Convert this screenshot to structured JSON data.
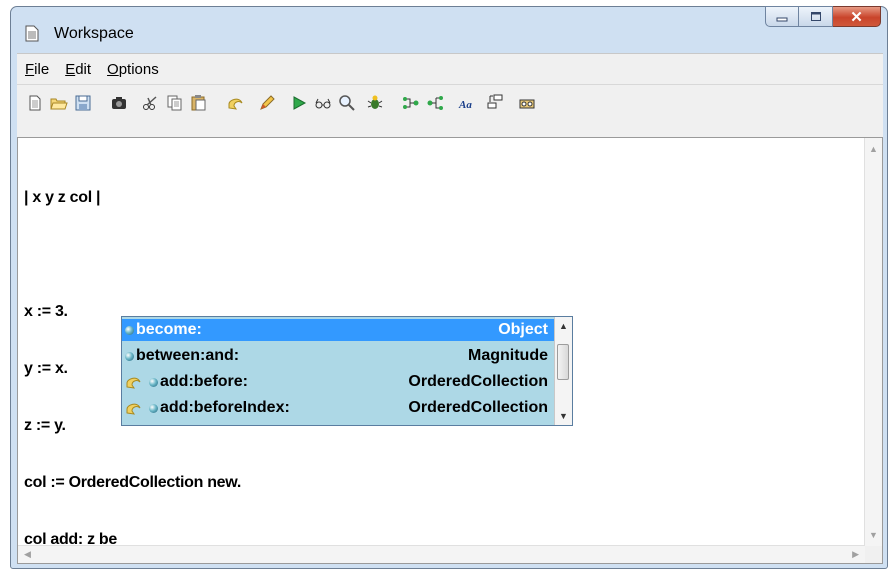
{
  "window": {
    "title": "Workspace"
  },
  "menu": {
    "items": [
      "File",
      "Edit",
      "Options"
    ]
  },
  "toolbar": {
    "icons": [
      "new-document-icon",
      "open-folder-icon",
      "save-icon",
      "camera-icon",
      "cut-icon",
      "copy-icon",
      "paste-icon",
      "undo-icon",
      "highlighter-icon",
      "run-icon",
      "inspect-glasses-icon",
      "magnifier-icon",
      "bug-icon",
      "step-into-icon",
      "step-over-icon",
      "font-icon",
      "structure-icon",
      "tape-icon"
    ]
  },
  "editor": {
    "lines": [
      "| x y z col |",
      "",
      "x := 3.",
      "y := x.",
      "z := y.",
      "col := OrderedCollection new.",
      "col add: z be"
    ]
  },
  "autocomplete": {
    "items": [
      {
        "name": "become:",
        "class": "Object",
        "selected": true,
        "extension": false
      },
      {
        "name": "between:and:",
        "class": "Magnitude",
        "selected": false,
        "extension": false
      },
      {
        "name": "add:before:",
        "class": "OrderedCollection",
        "selected": false,
        "extension": true
      },
      {
        "name": "add:beforeIndex:",
        "class": "OrderedCollection",
        "selected": false,
        "extension": true
      }
    ]
  },
  "colors": {
    "selection": "#3399ff",
    "popup_bg": "#add8e6",
    "close_button": "#c9442b"
  }
}
